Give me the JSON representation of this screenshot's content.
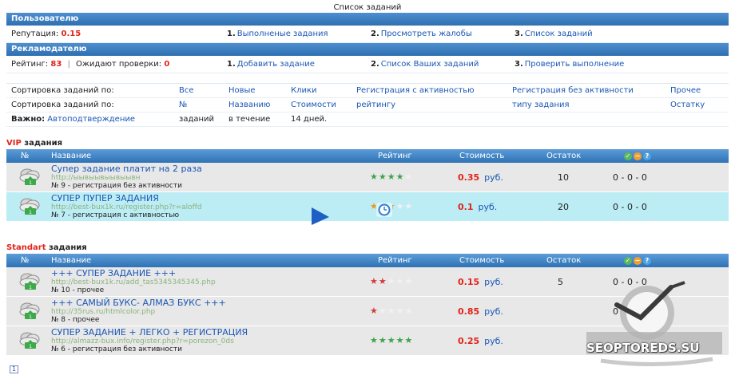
{
  "page_title": "Список заданий",
  "user_bar": {
    "title": "Пользователю",
    "reputation_label": "Репутация:",
    "reputation_value": "0.15",
    "links": [
      {
        "num": "1.",
        "label": "Выполненые задания"
      },
      {
        "num": "2.",
        "label": "Просмотреть жалобы"
      },
      {
        "num": "3.",
        "label": "Список заданий"
      }
    ]
  },
  "advertiser_bar": {
    "title": "Рекламодателю",
    "rating_label": "Рейтинг:",
    "rating_value": "83",
    "separator": "|",
    "pending_label": "Ожидают проверки:",
    "pending_value": "0",
    "links": [
      {
        "num": "1.",
        "label": "Добавить задание"
      },
      {
        "num": "2.",
        "label": "Список Ваших заданий"
      },
      {
        "num": "3.",
        "label": "Проверить выполнение"
      }
    ]
  },
  "sorting": {
    "row1": {
      "label": "Сортировка заданий по:",
      "options": [
        "Все",
        "Новые",
        "Клики",
        "Регистрация с активностью",
        "Регистрация без активности",
        "Прочее"
      ]
    },
    "row2": {
      "label": "Сортировка заданий по:",
      "options": [
        "№",
        "Названию",
        "Стоимости",
        "рейтингу",
        "типу задания",
        "Остатку"
      ]
    },
    "row3": {
      "label": "Важно:",
      "highlight": "Автоподтверждение",
      "parts": [
        "заданий",
        "в течение",
        "14 дней."
      ]
    }
  },
  "vip": {
    "accent": "VIP",
    "title": "задания",
    "columns": {
      "num": "№",
      "name": "Название",
      "rating": "Рейтинг",
      "cost": "Стоимость",
      "remain": "Остаток"
    },
    "rows": [
      {
        "title": "Супер задание платит на 2 раза",
        "url": "http://ыывыывыывыывн",
        "meta": "№ 9 - регистрация без активности",
        "stars": 4,
        "star_color": "#3ea34a",
        "price": "0.35",
        "currency": "руб.",
        "remain": "10",
        "counts": "0 - 0 - 0",
        "style": "gray"
      },
      {
        "title": "СУПЕР ПУПЕР ЗАДАНИЯ",
        "url": "http://best-bux1k.ru/register.php?r=aloffd",
        "meta": "№ 7 - регистрация с активностью",
        "stars": 3,
        "star_color": "#e59b1e",
        "price": "0.1",
        "currency": "руб.",
        "remain": "20",
        "counts": "0 - 0 - 0",
        "style": "cyan"
      }
    ]
  },
  "standart": {
    "accent": "Standart",
    "title": "задания",
    "columns": {
      "num": "№",
      "name": "Название",
      "rating": "Рейтинг",
      "cost": "Стоимость",
      "remain": "Остаток"
    },
    "rows": [
      {
        "title": "+++ СУПЕР ЗАДАНИЕ +++",
        "url": "http://best-bux1k.ru/add_tas5345345345.php",
        "meta": "№ 10 - прочее",
        "stars": 2,
        "star_color": "#d23b3b",
        "price": "0.15",
        "currency": "руб.",
        "remain": "5",
        "counts": "0 - 0 - 0",
        "style": "gray"
      },
      {
        "title": "+++ САМЫЙ БУКС- АЛМАЗ БУКС +++",
        "url": "http://35rus.ru/htmlcolor.php",
        "meta": "№ 8 - прочее",
        "stars": 1,
        "star_color": "#d23b3b",
        "price": "0.85",
        "currency": "руб.",
        "remain": "",
        "counts": "0",
        "style": "gray"
      },
      {
        "title": "СУПЕР ЗАДАНИЕ + ЛЕГКО + РЕГИСТРАЦИЯ",
        "url": "http://almazz-bux.info/register.php?r=porezon_0ds",
        "meta": "№ 6 - регистрация без активности",
        "stars": 5,
        "star_color": "#3ea34a",
        "price": "0.25",
        "currency": "руб.",
        "remain": "",
        "counts": "",
        "style": "gray"
      }
    ]
  },
  "pager": {
    "current": "1"
  },
  "watermark": {
    "text": "SEOPTOREDS.SU"
  },
  "colors": {
    "accent_red": "#e2231a",
    "link_blue": "#1a57b5",
    "header_blue": "#2f73b5",
    "row_gray": "#e8e8e8",
    "row_cyan": "#bcecf4"
  },
  "icons": {
    "task": "cloud-arrow-icon",
    "alarm": "alarm-clock-icon",
    "cursor": "mouse-pointer-icon",
    "approve": "check-circle-icon",
    "minus": "minus-circle-icon",
    "help": "help-circle-icon"
  }
}
